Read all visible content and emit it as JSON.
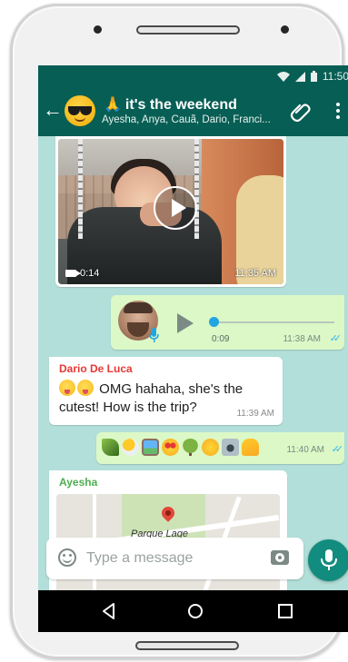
{
  "status_bar": {
    "time": "11:50"
  },
  "header": {
    "title": "it's the weekend",
    "title_emoji": "🙏",
    "subtitle": "Ayesha, Anya, Cauã, Dario, Franci..."
  },
  "messages": {
    "video": {
      "duration": "0:14",
      "time": "11:35 AM"
    },
    "voice": {
      "duration": "0:09",
      "time": "11:38 AM",
      "progress": 0
    },
    "dario": {
      "sender": "Dario De Luca",
      "sender_color": "#e53935",
      "text": "OMG hahaha, she's the cutest! How is the trip?",
      "time": "11:39 AM"
    },
    "emoji_msg": {
      "emojis": [
        "herb-icon",
        "sun-behind-cloud-icon",
        "framed-picture-icon",
        "heart-eyes-icon",
        "tree-icon",
        "smiling-face-icon",
        "camera-with-flash-icon",
        "thumbs-up-icon"
      ],
      "time": "11:40 AM"
    },
    "ayesha": {
      "sender": "Ayesha",
      "sender_color": "#4caf50",
      "map_label": "Parque Lage"
    }
  },
  "input": {
    "placeholder": "Type a message",
    "value": ""
  },
  "colors": {
    "header": "#075e54",
    "chat_bg": "#b2dfd9",
    "outgoing": "#dcf8c6",
    "mic_button": "#128c7e",
    "read_ticks": "#34b7f1"
  }
}
